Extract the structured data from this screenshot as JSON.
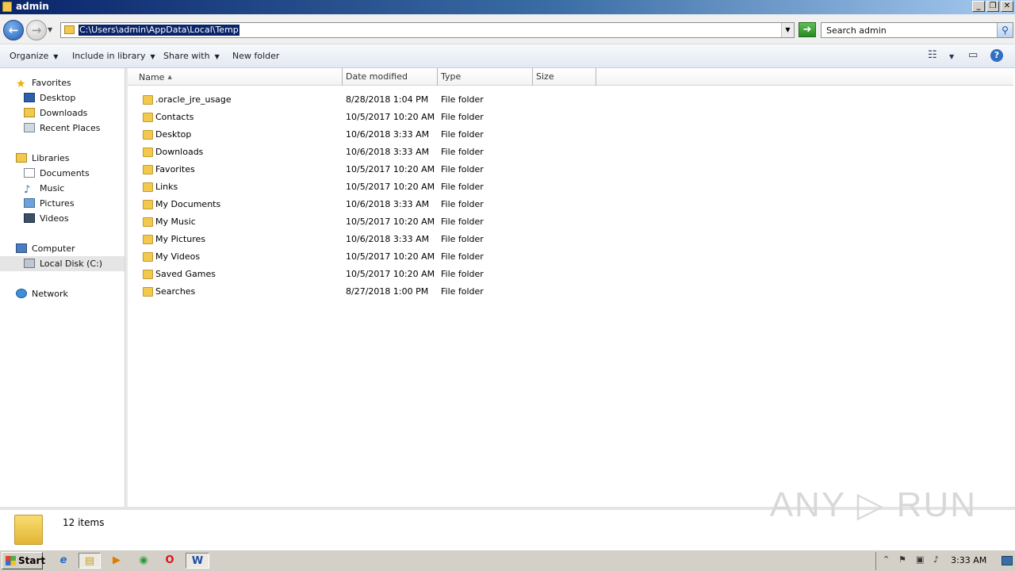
{
  "window": {
    "title": "admin"
  },
  "window_buttons": {
    "minimize": "_",
    "maximize": "❐",
    "close": "✕"
  },
  "address": {
    "path": "C:\\Users\\admin\\AppData\\Local\\Temp",
    "search_placeholder": "Search admin",
    "back_glyph": "←",
    "forward_glyph": "→",
    "go_glyph": "➜",
    "dropdown_glyph": "▼",
    "search_glyph": "⚲"
  },
  "toolbar": {
    "organize": "Organize",
    "include_in_library": "Include in library",
    "share_with": "Share with",
    "new_folder": "New folder",
    "views_glyph": "☷",
    "preview_glyph": "▭",
    "help_glyph": "?"
  },
  "nav": {
    "favorites": "Favorites",
    "desktop": "Desktop",
    "downloads": "Downloads",
    "recent_places": "Recent Places",
    "libraries": "Libraries",
    "documents": "Documents",
    "music": "Music",
    "pictures": "Pictures",
    "videos": "Videos",
    "computer": "Computer",
    "local_disk": "Local Disk (C:)",
    "network": "Network"
  },
  "columns": {
    "name": "Name",
    "date_modified": "Date modified",
    "type": "Type",
    "size": "Size"
  },
  "files": [
    {
      "name": ".oracle_jre_usage",
      "date": "8/28/2018 1:04 PM",
      "type": "File folder"
    },
    {
      "name": "Contacts",
      "date": "10/5/2017 10:20 AM",
      "type": "File folder"
    },
    {
      "name": "Desktop",
      "date": "10/6/2018 3:33 AM",
      "type": "File folder"
    },
    {
      "name": "Downloads",
      "date": "10/6/2018 3:33 AM",
      "type": "File folder"
    },
    {
      "name": "Favorites",
      "date": "10/5/2017 10:20 AM",
      "type": "File folder"
    },
    {
      "name": "Links",
      "date": "10/5/2017 10:20 AM",
      "type": "File folder"
    },
    {
      "name": "My Documents",
      "date": "10/6/2018 3:33 AM",
      "type": "File folder"
    },
    {
      "name": "My Music",
      "date": "10/5/2017 10:20 AM",
      "type": "File folder"
    },
    {
      "name": "My Pictures",
      "date": "10/6/2018 3:33 AM",
      "type": "File folder"
    },
    {
      "name": "My Videos",
      "date": "10/5/2017 10:20 AM",
      "type": "File folder"
    },
    {
      "name": "Saved Games",
      "date": "10/5/2017 10:20 AM",
      "type": "File folder"
    },
    {
      "name": "Searches",
      "date": "8/27/2018 1:00 PM",
      "type": "File folder"
    }
  ],
  "status": {
    "item_count": "12 items",
    "watermark": "ANY ▷ RUN"
  },
  "taskbar": {
    "start": "Start",
    "clock": "3:33 AM",
    "ie_glyph": "e",
    "explorer_glyph": "▤",
    "media_glyph": "▶",
    "chrome_glyph": "◉",
    "opera_glyph": "O",
    "word_glyph": "W",
    "tray_up_glyph": "⌃",
    "tray_flag_glyph": "⚑",
    "tray_network_glyph": "▣",
    "tray_volume_glyph": "♪"
  },
  "colors": {
    "selection": "#0a246a",
    "folder": "#f2c94c",
    "title_gradient_start": "#0a246a"
  }
}
